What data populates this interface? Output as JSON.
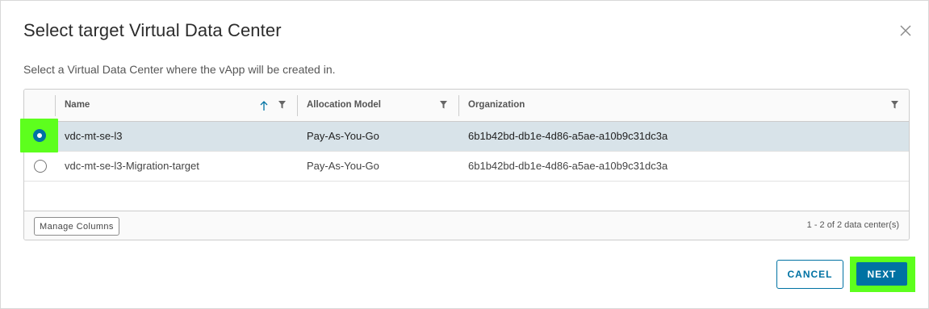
{
  "dialog": {
    "title": "Select target Virtual Data Center",
    "subtitle": "Select a Virtual Data Center where the vApp will be created in."
  },
  "grid": {
    "columns": [
      {
        "label": "Name",
        "sorted": "ascending",
        "filter_icon": "filter-icon"
      },
      {
        "label": "Allocation Model",
        "filter_icon": "filter-icon"
      },
      {
        "label": "Organization",
        "filter_icon": "filter-icon"
      }
    ],
    "rows": [
      {
        "selected": true,
        "name": "vdc-mt-se-l3",
        "allocation_model": "Pay-As-You-Go",
        "organization": "6b1b42bd-db1e-4d86-a5ae-a10b9c31dc3a"
      },
      {
        "selected": false,
        "name": "vdc-mt-se-l3-Migration-target",
        "allocation_model": "Pay-As-You-Go",
        "organization": "6b1b42bd-db1e-4d86-a5ae-a10b9c31dc3a"
      }
    ],
    "footer": {
      "manage_columns_label": "Manage Columns",
      "pagination": "1 - 2 of 2 data center(s)"
    }
  },
  "actions": {
    "cancel_label": "CANCEL",
    "next_label": "NEXT"
  },
  "colors": {
    "primary": "#0072a3",
    "selected_row": "#d8e3e9",
    "highlight": "#5dff1d"
  }
}
